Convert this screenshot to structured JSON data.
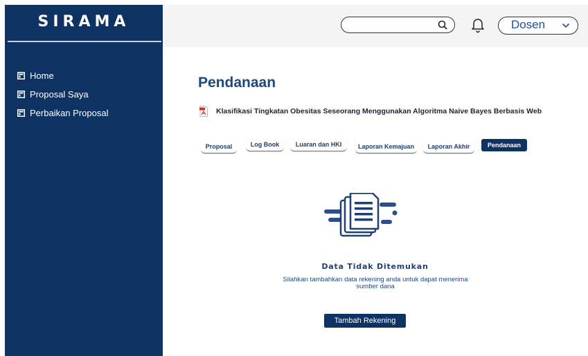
{
  "app": {
    "logo": "SIRAMA"
  },
  "sidebar": {
    "items": [
      {
        "label": "Home",
        "icon": "document-icon"
      },
      {
        "label": "Proposal Saya",
        "icon": "document-icon"
      },
      {
        "label": "Perbaikan Proposal",
        "icon": "document-icon"
      }
    ]
  },
  "topbar": {
    "search": {
      "value": "",
      "placeholder": ""
    },
    "role": {
      "selected": "Dosen"
    }
  },
  "main": {
    "title": "Pendanaan",
    "document": {
      "title": "Klasifikasi Tingkatan Obesitas Seseorang Menggunakan Algoritma Naive Bayes Berbasis Web",
      "icon": "pdf-icon"
    },
    "tabs": [
      {
        "label": "Proposal",
        "active": false
      },
      {
        "label": "Log Book",
        "active": false
      },
      {
        "label": "Luaran dan HKI",
        "active": false
      },
      {
        "label": "Laporan Kemajuan",
        "active": false
      },
      {
        "label": "Laporan Akhir",
        "active": false
      },
      {
        "label": "Pendanaan",
        "active": true
      }
    ],
    "empty_state": {
      "title": "Data Tidak Ditemukan",
      "description": "Silahkan tambahkan data rekening anda untuk dapat menerima sumber dana",
      "button_label": "Tambah Rekening",
      "illustration": "document-list-icon"
    }
  },
  "colors": {
    "primary": "#0e3363",
    "title": "#1d4783",
    "topbar": "#f4f4f4",
    "text": "#1f2430"
  }
}
